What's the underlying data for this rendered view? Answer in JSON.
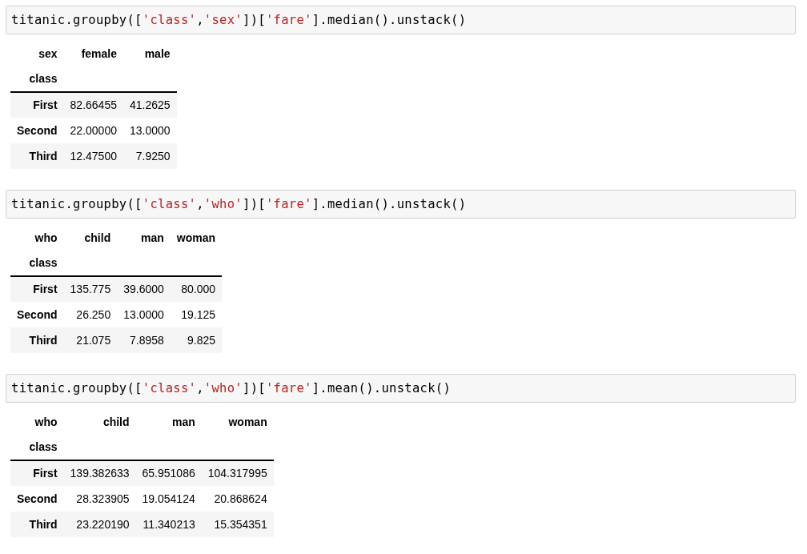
{
  "cells": [
    {
      "code": [
        {
          "kind": "plain",
          "text": "titanic.groupby(["
        },
        {
          "kind": "string",
          "text": "'class'"
        },
        {
          "kind": "plain",
          "text": ","
        },
        {
          "kind": "string",
          "text": "'sex'"
        },
        {
          "kind": "plain",
          "text": "])["
        },
        {
          "kind": "string",
          "text": "'fare'"
        },
        {
          "kind": "plain",
          "text": "].median().unstack()"
        }
      ],
      "table": {
        "columns_name": "sex",
        "index_name": "class",
        "columns": [
          "female",
          "male"
        ],
        "rows": [
          {
            "label": "First",
            "values": [
              "82.66455",
              "41.2625"
            ]
          },
          {
            "label": "Second",
            "values": [
              "22.00000",
              "13.0000"
            ]
          },
          {
            "label": "Third",
            "values": [
              "12.47500",
              "7.9250"
            ]
          }
        ]
      }
    },
    {
      "code": [
        {
          "kind": "plain",
          "text": "titanic.groupby(["
        },
        {
          "kind": "string",
          "text": "'class'"
        },
        {
          "kind": "plain",
          "text": ","
        },
        {
          "kind": "string",
          "text": "'who'"
        },
        {
          "kind": "plain",
          "text": "])["
        },
        {
          "kind": "string",
          "text": "'fare'"
        },
        {
          "kind": "plain",
          "text": "].median().unstack()"
        }
      ],
      "table": {
        "columns_name": "who",
        "index_name": "class",
        "columns": [
          "child",
          "man",
          "woman"
        ],
        "rows": [
          {
            "label": "First",
            "values": [
              "135.775",
              "39.6000",
              "80.000"
            ]
          },
          {
            "label": "Second",
            "values": [
              "26.250",
              "13.0000",
              "19.125"
            ]
          },
          {
            "label": "Third",
            "values": [
              "21.075",
              "7.8958",
              "9.825"
            ]
          }
        ]
      }
    },
    {
      "code": [
        {
          "kind": "plain",
          "text": "titanic.groupby(["
        },
        {
          "kind": "string",
          "text": "'class'"
        },
        {
          "kind": "plain",
          "text": ","
        },
        {
          "kind": "string",
          "text": "'who'"
        },
        {
          "kind": "plain",
          "text": "])["
        },
        {
          "kind": "string",
          "text": "'fare'"
        },
        {
          "kind": "plain",
          "text": "].mean().unstack()"
        }
      ],
      "table": {
        "columns_name": "who",
        "index_name": "class",
        "columns": [
          "child",
          "man",
          "woman"
        ],
        "rows": [
          {
            "label": "First",
            "values": [
              "139.382633",
              "65.951086",
              "104.317995"
            ]
          },
          {
            "label": "Second",
            "values": [
              "28.323905",
              "19.054124",
              "20.868624"
            ]
          },
          {
            "label": "Third",
            "values": [
              "23.220190",
              "11.340213",
              "15.354351"
            ]
          }
        ]
      }
    }
  ]
}
